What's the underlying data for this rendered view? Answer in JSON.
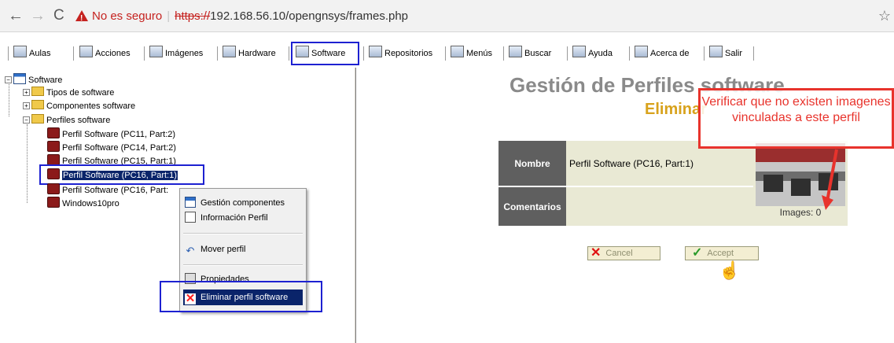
{
  "browser": {
    "security_label": "No es seguro",
    "url_scheme": "https://",
    "url_rest": "192.168.56.10/opengnsys/frames.php"
  },
  "toolbar": {
    "items": [
      "Aulas",
      "Acciones",
      "Imágenes",
      "Hardware",
      "Software",
      "Repositorios",
      "Menús",
      "Buscar",
      "Ayuda",
      "Acerca de",
      "Salir"
    ],
    "active": "Software"
  },
  "tree": {
    "root": "Software",
    "nodes": [
      "Tipos de software",
      "Componentes software",
      "Perfiles software"
    ],
    "profiles": [
      "Perfil Software (PC11, Part:2)",
      "Perfil Software (PC14, Part:2)",
      "Perfil Software (PC15, Part:1)",
      "Perfil Software (PC16, Part:1)",
      "Perfil Software (PC16, Part:",
      "Windows10pro"
    ],
    "selected_index": 3
  },
  "context_menu": {
    "items": [
      "Gestión componentes",
      "Información Perfil",
      "Mover perfil",
      "Propiedades",
      "Eliminar perfil software"
    ],
    "highlighted": "Eliminar perfil software"
  },
  "main": {
    "title": "Gestión de Perfiles software",
    "subtitle": "Eliminar",
    "name_label": "Nombre",
    "name_value": "Perfil Software (PC16, Part:1)",
    "comments_label": "Comentarios",
    "comments_value": "",
    "images_label": "Images: 0",
    "cancel_label": "Cancel",
    "accept_label": "Accept"
  },
  "annotation": {
    "text": "Verificar que no existen imagenes vinculadas a este perfil"
  },
  "colors": {
    "highlight_box": "#1d21d1",
    "annotation": "#e8332c",
    "selection": "#0a246a",
    "subtitle": "#d8a21c"
  }
}
